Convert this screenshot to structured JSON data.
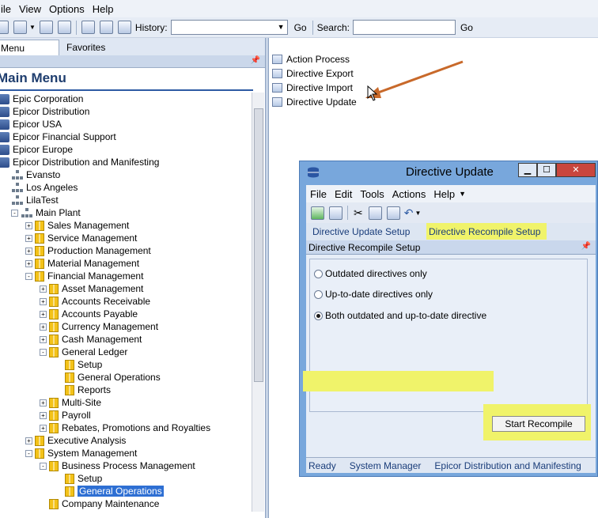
{
  "menubar": {
    "items": [
      "ile",
      "View",
      "Options",
      "Help"
    ]
  },
  "toolbar": {
    "history_label": "History:",
    "go_label": "Go",
    "search_label": "Search:",
    "search_go_label": "Go"
  },
  "left_pane": {
    "tabs": [
      "Menu Groups",
      "Favorites"
    ],
    "title": "Main Menu",
    "tree": [
      {
        "label": "Epic Corporation",
        "level": 0,
        "icon": "database-icon",
        "toggle": ""
      },
      {
        "label": "Epicor Distribution",
        "level": 0,
        "icon": "database-icon",
        "toggle": ""
      },
      {
        "label": "Epicor USA",
        "level": 0,
        "icon": "database-icon",
        "toggle": ""
      },
      {
        "label": "Epicor Financial Support",
        "level": 0,
        "icon": "database-icon",
        "toggle": ""
      },
      {
        "label": "Epicor Europe",
        "level": 0,
        "icon": "database-icon",
        "toggle": ""
      },
      {
        "label": "Epicor Distribution and Manifesting",
        "level": 0,
        "icon": "database-icon",
        "toggle": ""
      },
      {
        "label": "Evansto",
        "level": 1,
        "icon": "org-chart-icon",
        "toggle": ""
      },
      {
        "label": "Los Angeles",
        "level": 1,
        "icon": "org-chart-icon",
        "toggle": ""
      },
      {
        "label": "LilaTest",
        "level": 1,
        "icon": "org-chart-icon",
        "toggle": ""
      },
      {
        "label": "Main Plant",
        "level": 1,
        "icon": "org-chart-icon",
        "toggle": "-"
      },
      {
        "label": "Sales Management",
        "level": 2,
        "icon": "folder-icon",
        "toggle": "+"
      },
      {
        "label": "Service Management",
        "level": 2,
        "icon": "folder-icon",
        "toggle": "+"
      },
      {
        "label": "Production Management",
        "level": 2,
        "icon": "folder-icon",
        "toggle": "+"
      },
      {
        "label": "Material Management",
        "level": 2,
        "icon": "folder-icon",
        "toggle": "+"
      },
      {
        "label": "Financial Management",
        "level": 2,
        "icon": "folder-icon",
        "toggle": "-"
      },
      {
        "label": "Asset Management",
        "level": 3,
        "icon": "folder-icon",
        "toggle": "+"
      },
      {
        "label": "Accounts Receivable",
        "level": 3,
        "icon": "folder-icon",
        "toggle": "+"
      },
      {
        "label": "Accounts Payable",
        "level": 3,
        "icon": "folder-icon",
        "toggle": "+"
      },
      {
        "label": "Currency Management",
        "level": 3,
        "icon": "folder-icon",
        "toggle": "+"
      },
      {
        "label": "Cash Management",
        "level": 3,
        "icon": "folder-icon",
        "toggle": "+"
      },
      {
        "label": "General Ledger",
        "level": 3,
        "icon": "folder-icon",
        "toggle": "-"
      },
      {
        "label": "Setup",
        "level": 4,
        "icon": "folder-icon",
        "toggle": ""
      },
      {
        "label": "General Operations",
        "level": 4,
        "icon": "folder-icon",
        "toggle": ""
      },
      {
        "label": "Reports",
        "level": 4,
        "icon": "folder-icon",
        "toggle": ""
      },
      {
        "label": "Multi-Site",
        "level": 3,
        "icon": "folder-icon",
        "toggle": "+"
      },
      {
        "label": "Payroll",
        "level": 3,
        "icon": "folder-icon",
        "toggle": "+"
      },
      {
        "label": "Rebates, Promotions and Royalties",
        "level": 3,
        "icon": "folder-icon",
        "toggle": "+"
      },
      {
        "label": "Executive Analysis",
        "level": 2,
        "icon": "folder-icon",
        "toggle": "+"
      },
      {
        "label": "System Management",
        "level": 2,
        "icon": "folder-icon",
        "toggle": "-"
      },
      {
        "label": "Business Process Management",
        "level": 3,
        "icon": "folder-icon",
        "toggle": "-"
      },
      {
        "label": "Setup",
        "level": 4,
        "icon": "folder-icon",
        "toggle": ""
      },
      {
        "label": "General Operations",
        "level": 4,
        "icon": "folder-icon",
        "toggle": "",
        "selected": true
      },
      {
        "label": "Company Maintenance",
        "level": 3,
        "icon": "folder-icon",
        "toggle": ""
      }
    ]
  },
  "right_pane": {
    "items": [
      "Action Process",
      "Directive Export",
      "Directive Import",
      "Directive Update"
    ]
  },
  "dialog": {
    "title": "Directive Update",
    "menu": [
      "File",
      "Edit",
      "Tools",
      "Actions",
      "Help"
    ],
    "tabs": [
      "Directive Update Setup",
      "Directive Recompile Setup"
    ],
    "panel_title": "Directive Recompile Setup",
    "options": [
      {
        "label": "Outdated directives only",
        "checked": false
      },
      {
        "label": "Up-to-date directives only",
        "checked": false
      },
      {
        "label": "Both outdated and up-to-date directive",
        "checked": true
      }
    ],
    "start_button": "Start Recompile",
    "status": [
      "Ready",
      "System Manager",
      "Epicor Distribution and Manifesting"
    ]
  },
  "colors": {
    "highlight": "#f0f36a",
    "selection": "#2e6fd3",
    "arrow": "#c8692a"
  }
}
